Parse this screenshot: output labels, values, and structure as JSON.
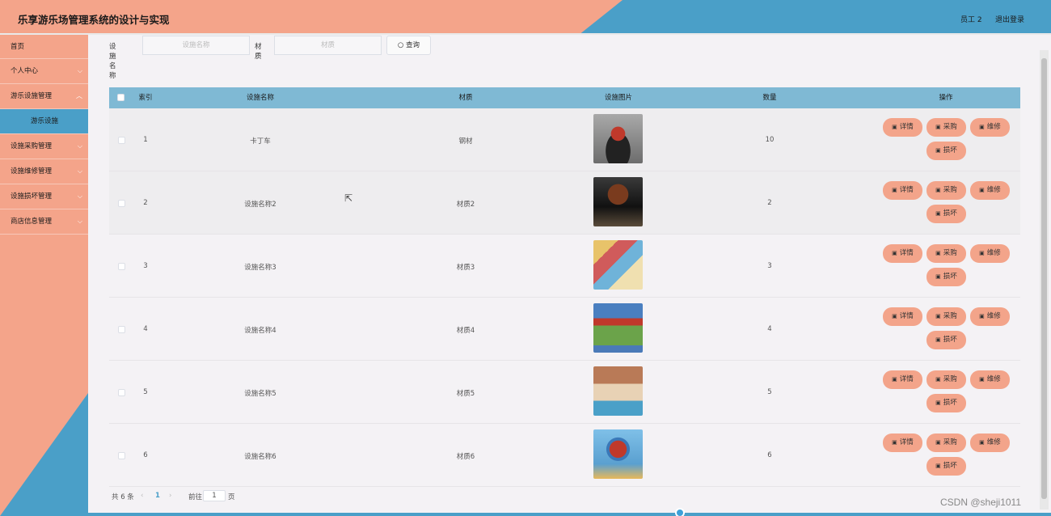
{
  "header": {
    "title": "乐享游乐场管理系统的设计与实现",
    "user": "员工 2",
    "logout": "退出登录"
  },
  "sidebar": {
    "items": [
      {
        "label": "首页"
      },
      {
        "label": "个人中心"
      },
      {
        "label": "游乐设施管理"
      },
      {
        "label": "游乐设施"
      },
      {
        "label": "设施采购管理"
      },
      {
        "label": "设施维修管理"
      },
      {
        "label": "设施损坏管理"
      },
      {
        "label": "商店信息管理"
      }
    ]
  },
  "search": {
    "name_label": "设施名称",
    "name_placeholder": "设施名称",
    "material_label": "材质",
    "material_placeholder": "材质",
    "button": "查询"
  },
  "table": {
    "headers": [
      "索引",
      "设施名称",
      "材质",
      "设施图片",
      "数量",
      "操作"
    ],
    "rows": [
      {
        "index": "1",
        "name": "卡丁车",
        "material": "钢材",
        "qty": "10"
      },
      {
        "index": "2",
        "name": "设施名称2",
        "material": "材质2",
        "qty": "2"
      },
      {
        "index": "3",
        "name": "设施名称3",
        "material": "材质3",
        "qty": "3"
      },
      {
        "index": "4",
        "name": "设施名称4",
        "material": "材质4",
        "qty": "4"
      },
      {
        "index": "5",
        "name": "设施名称5",
        "material": "材质5",
        "qty": "5"
      },
      {
        "index": "6",
        "name": "设施名称6",
        "material": "材质6",
        "qty": "6"
      }
    ],
    "ops": {
      "detail": "详情",
      "purchase": "采购",
      "repair": "维修",
      "damage": "损坏"
    }
  },
  "pager": {
    "total": "共 6 条",
    "current": "1",
    "goto": "前往",
    "goto_value": "1",
    "page_unit": "页"
  },
  "watermark": "CSDN @sheji1011",
  "colors": {
    "salmon": "#f4a48a",
    "blue": "#4a9fc8",
    "header_row": "#7fb9d4"
  }
}
